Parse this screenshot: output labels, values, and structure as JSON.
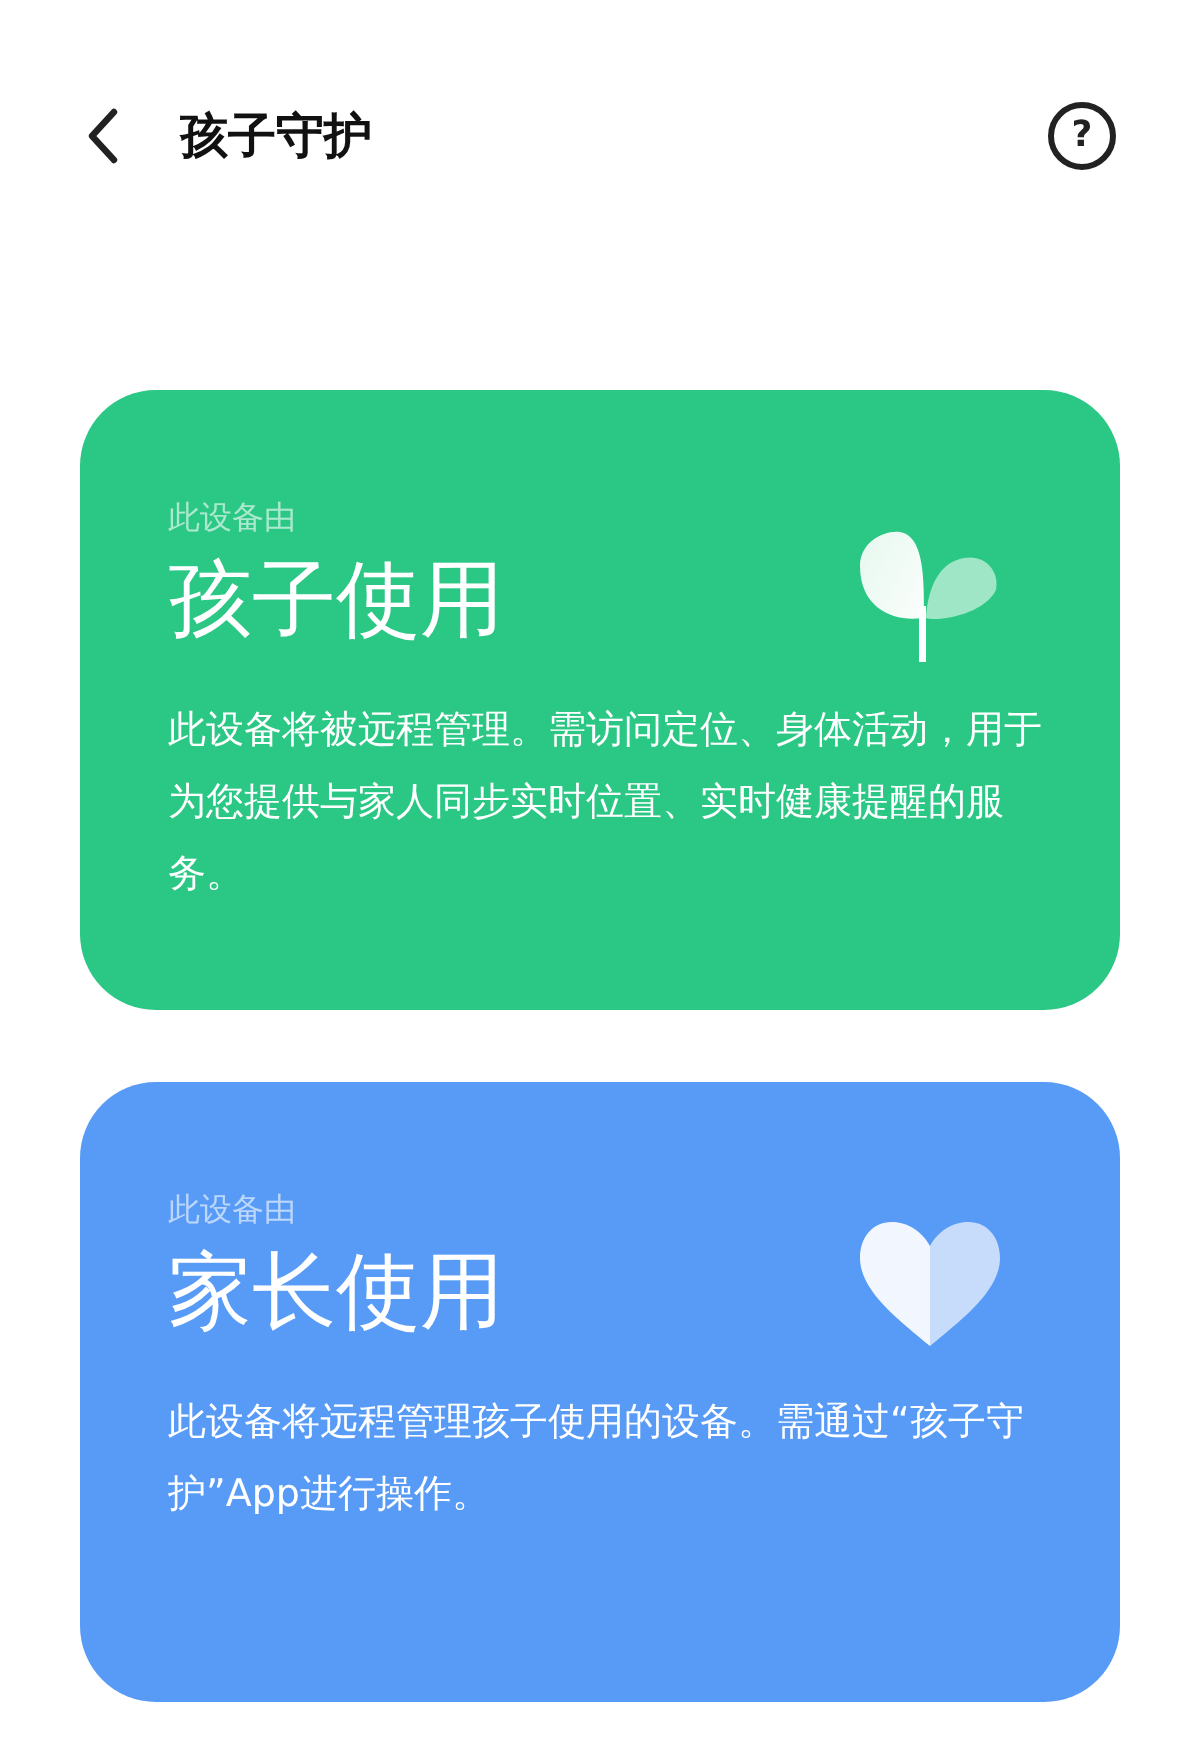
{
  "header": {
    "title": "孩子守护",
    "help": "?"
  },
  "cards": [
    {
      "kind": "child",
      "caption": "此设备由",
      "title": "孩子使用",
      "description": "此设备将被远程管理。需访问定位、身体活动，用于为您提供与家人同步实时位置、实时健康提醒的服务。"
    },
    {
      "kind": "parent",
      "caption": "此设备由",
      "title": "家长使用",
      "description": "此设备将远程管理孩子使用的设备。需通过“孩子守护”App进行操作。"
    }
  ]
}
